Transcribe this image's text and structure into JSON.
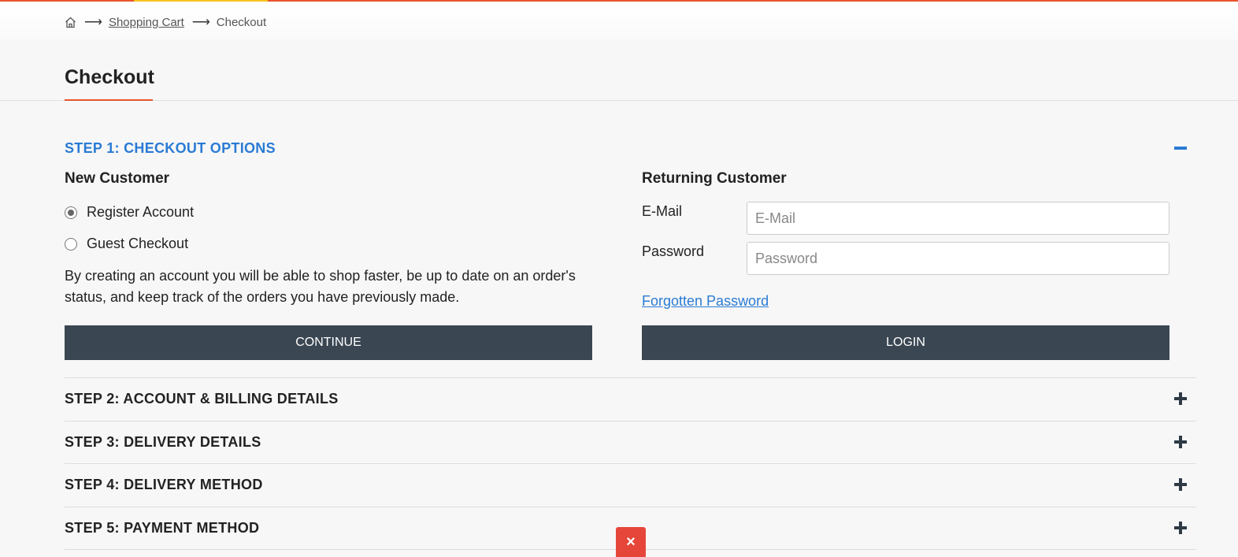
{
  "breadcrumb": {
    "home_icon": "home-icon",
    "arrow": "⟶",
    "items": [
      "Shopping Cart",
      "Checkout"
    ]
  },
  "page_title": "Checkout",
  "step1": {
    "heading": "STEP 1: CHECKOUT OPTIONS",
    "collapse_icon": "minus-icon",
    "new_customer": {
      "heading": "New Customer",
      "options": [
        {
          "label": "Register Account",
          "checked": true
        },
        {
          "label": "Guest Checkout",
          "checked": false
        }
      ],
      "description": "By creating an account you will be able to shop faster, be up to date on an order's status, and keep track of the orders you have previously made.",
      "continue_label": "CONTINUE"
    },
    "returning_customer": {
      "heading": "Returning Customer",
      "email_label": "E-Mail",
      "email_placeholder": "E-Mail",
      "password_label": "Password",
      "password_placeholder": "Password",
      "forgot_label": "Forgotten Password",
      "login_label": "LOGIN"
    }
  },
  "steps": [
    {
      "title": "STEP 2: ACCOUNT & BILLING DETAILS"
    },
    {
      "title": "STEP 3: DELIVERY DETAILS"
    },
    {
      "title": "STEP 4: DELIVERY METHOD"
    },
    {
      "title": "STEP 5: PAYMENT METHOD"
    }
  ],
  "close_label": "×",
  "colors": {
    "accent_orange": "#e9542e",
    "accent_yellow": "#f7c31f",
    "link_blue": "#2a7bd4",
    "button_dark": "#3a4652",
    "close_red": "#e6463a"
  }
}
